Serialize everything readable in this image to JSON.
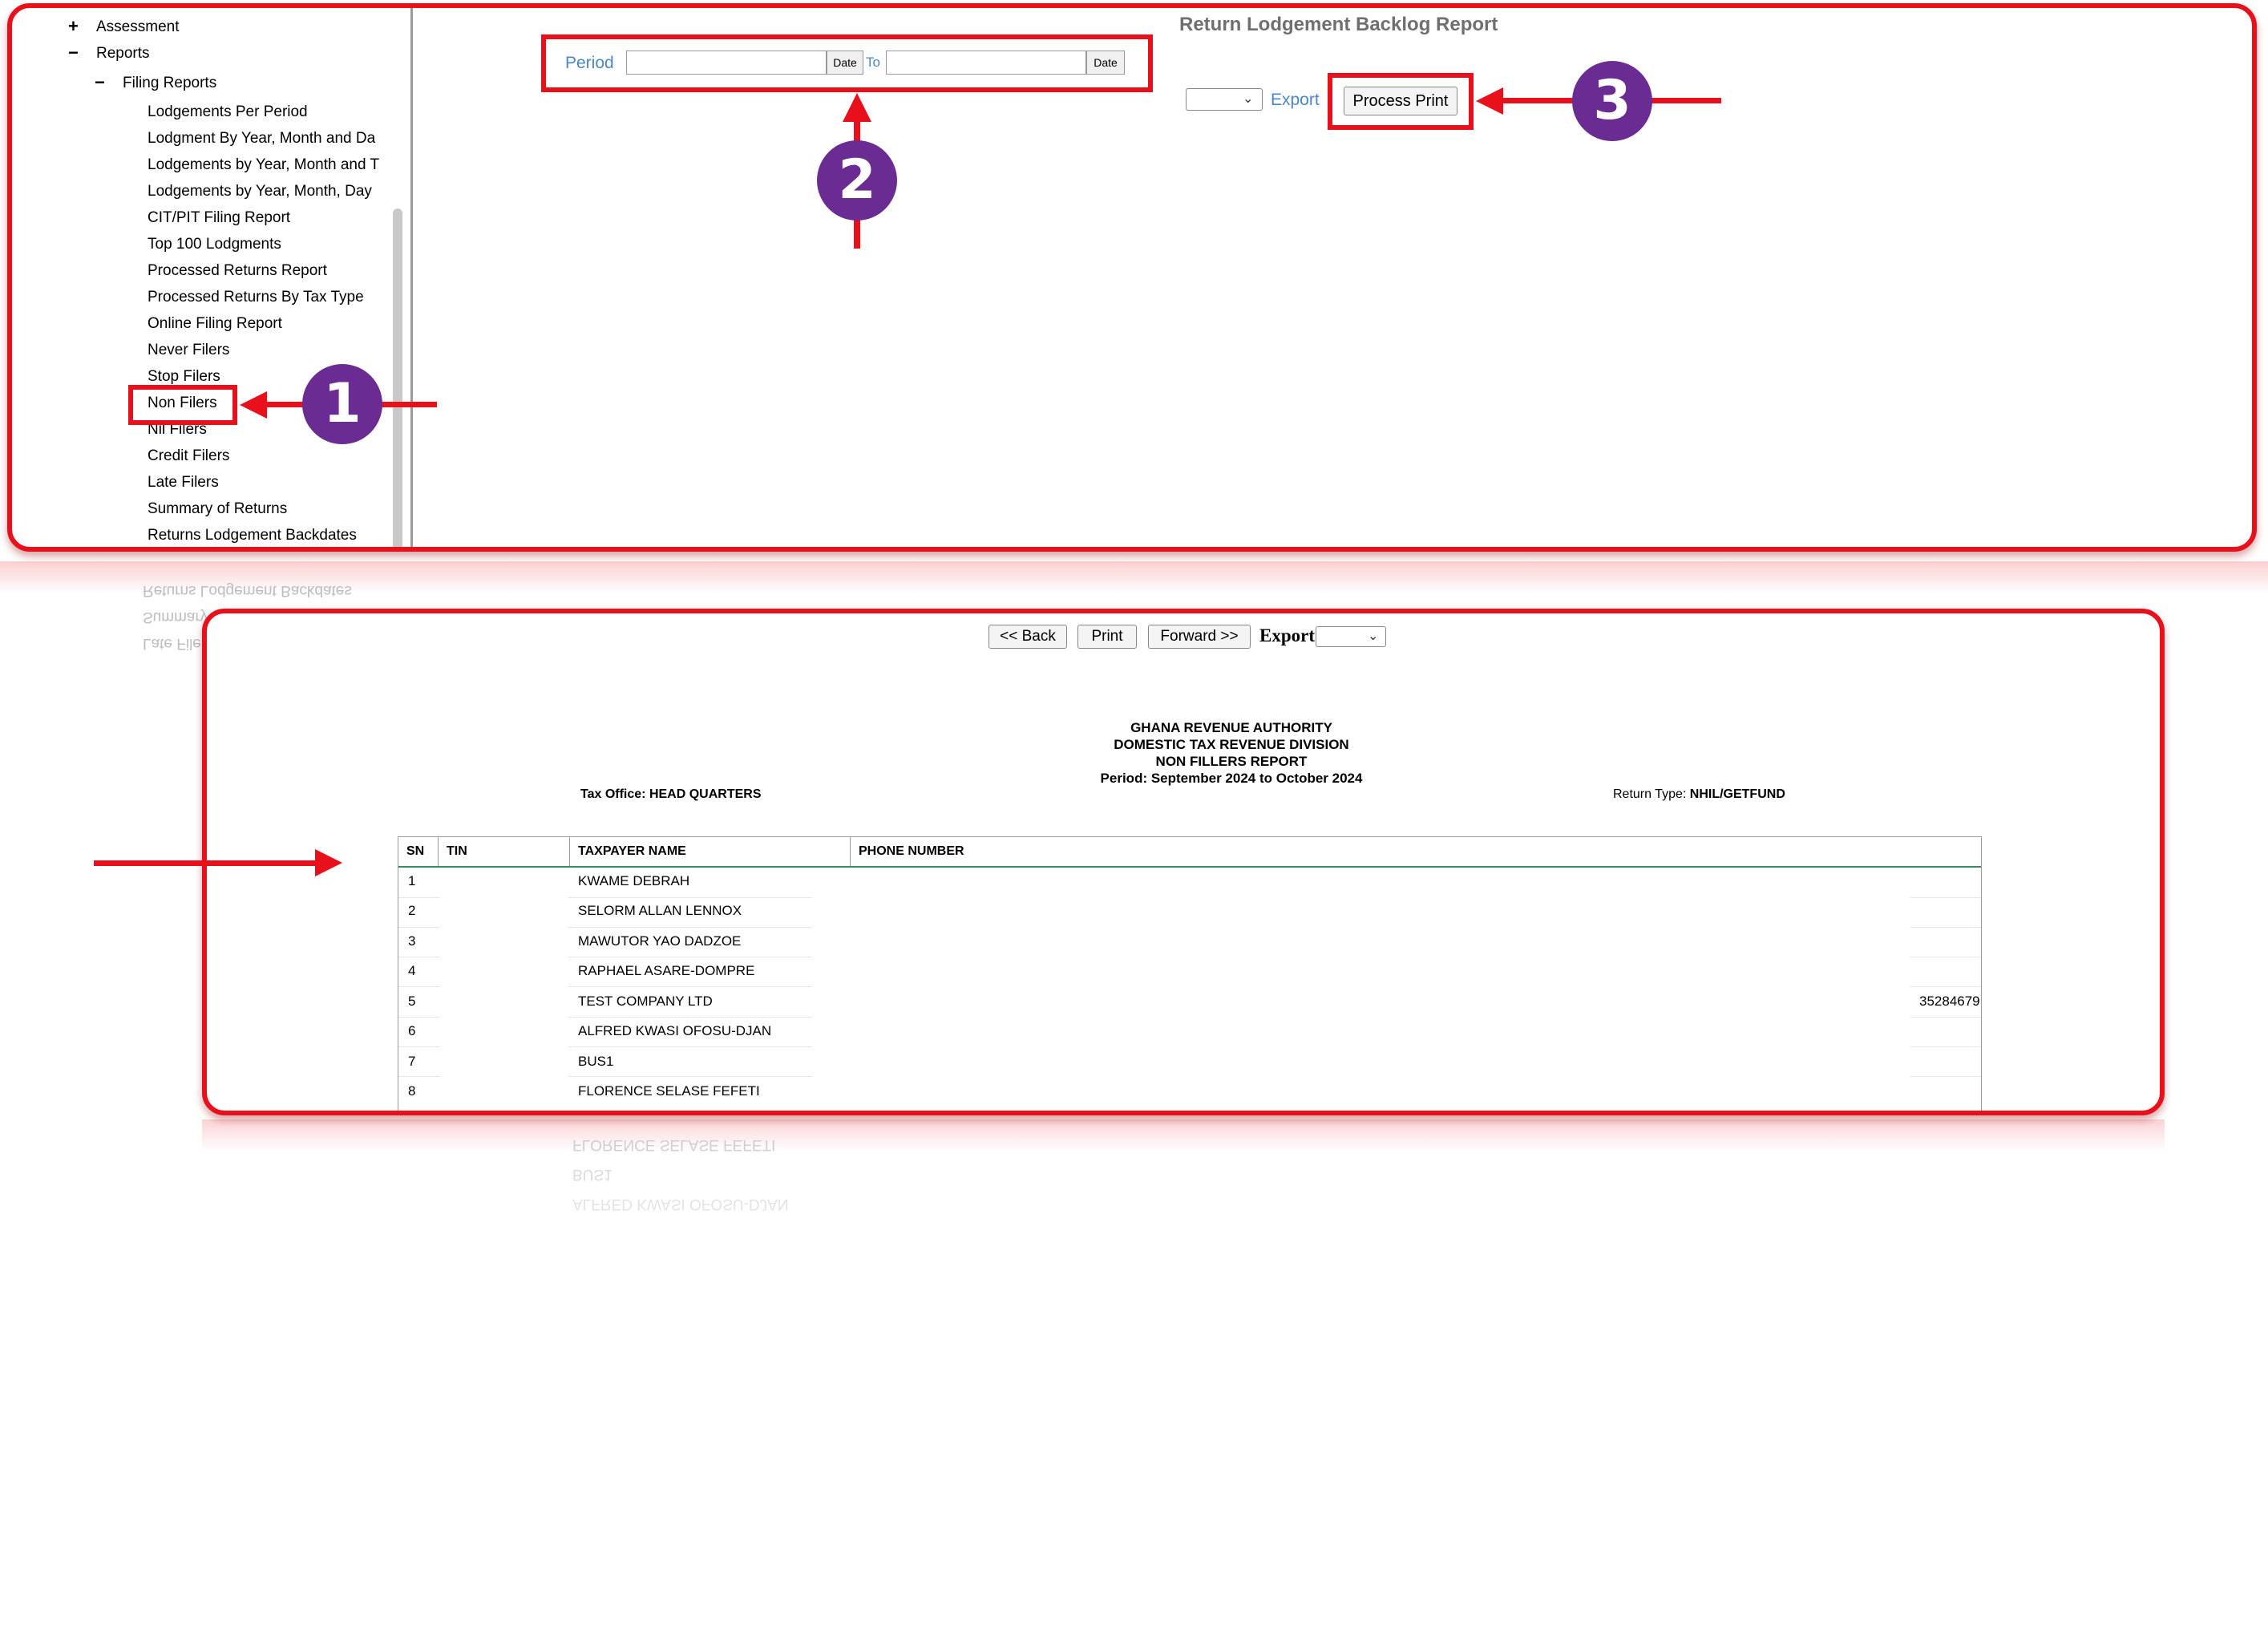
{
  "sidebar": {
    "items": [
      {
        "sign": "+",
        "label": "Assessment"
      },
      {
        "sign": "−",
        "label": "Reports"
      },
      {
        "sign": "−",
        "label": "Filing Reports"
      },
      {
        "label": "Lodgements Per Period"
      },
      {
        "label": "Lodgment By Year, Month and Da"
      },
      {
        "label": "Lodgements by Year, Month and T"
      },
      {
        "label": "Lodgements by Year, Month, Day"
      },
      {
        "label": "CIT/PIT Filing Report"
      },
      {
        "label": "Top 100 Lodgments"
      },
      {
        "label": "Processed Returns Report"
      },
      {
        "label": "Processed Returns By Tax Type"
      },
      {
        "label": "Online Filing Report"
      },
      {
        "label": "Never Filers"
      },
      {
        "label": "Stop Filers"
      },
      {
        "label": "Non Filers"
      },
      {
        "label": "Nil Filers"
      },
      {
        "label": "Credit Filers"
      },
      {
        "label": "Late Filers"
      },
      {
        "label": "Summary of Returns"
      },
      {
        "label": "Returns Lodgement Backdates"
      }
    ]
  },
  "report_form": {
    "title": "Return Lodgement Backlog Report",
    "period_label": "Period",
    "date_button": "Date",
    "to_label": "To",
    "export_label": "Export",
    "process_print_label": "Process Print"
  },
  "annotations": {
    "step1": "1",
    "step2": "2",
    "step3": "3"
  },
  "viewer": {
    "back_label": "<< Back",
    "print_label": "Print",
    "forward_label": "Forward >>",
    "export_label": "Export"
  },
  "report": {
    "org": "GHANA REVENUE AUTHORITY",
    "division": "DOMESTIC TAX REVENUE DIVISION",
    "name": "NON FILLERS REPORT",
    "period": "Period: September 2024 to October 2024",
    "tax_office_label": "Tax Office:",
    "tax_office_value": "HEAD QUARTERS",
    "return_type_label": "Return Type:",
    "return_type_value": "NHIL/GETFUND",
    "columns": [
      "SN",
      "TIN",
      "TAXPAYER NAME",
      "PHONE NUMBER"
    ],
    "rows": [
      {
        "sn": "1",
        "name": "KWAME DEBRAH",
        "phone": ""
      },
      {
        "sn": "2",
        "name": "SELORM ALLAN LENNOX",
        "phone": ""
      },
      {
        "sn": "3",
        "name": "MAWUTOR YAO DADZOE",
        "phone": ""
      },
      {
        "sn": "4",
        "name": "RAPHAEL ASARE-DOMPRE",
        "phone": ""
      },
      {
        "sn": "5",
        "name": "TEST COMPANY LTD",
        "phone": "35284679"
      },
      {
        "sn": "6",
        "name": "ALFRED KWASI OFOSU-DJAN",
        "phone": ""
      },
      {
        "sn": "7",
        "name": "BUS1",
        "phone": ""
      },
      {
        "sn": "8",
        "name": "FLORENCE SELASE FEFETI",
        "phone": ""
      }
    ]
  },
  "colors": {
    "highlight": "#e8101a",
    "badge": "#6a2b93",
    "link": "#4a86c8"
  }
}
